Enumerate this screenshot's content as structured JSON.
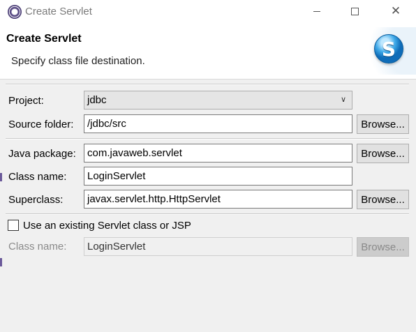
{
  "window": {
    "title": "Create Servlet",
    "icon": "eclipse-icon",
    "controls": {
      "minimize": "minimize-icon",
      "maximize": "maximize-icon",
      "close": "✕"
    }
  },
  "banner": {
    "title": "Create Servlet",
    "description": "Specify class file destination.",
    "logo_letter": "S"
  },
  "form": {
    "project": {
      "label": "Project:",
      "value": "jdbc"
    },
    "source_folder": {
      "label": "Source folder:",
      "value": "/jdbc/src",
      "button": "Browse..."
    },
    "java_package": {
      "label": "Java package:",
      "value": "com.javaweb.servlet",
      "button": "Browse..."
    },
    "class_name": {
      "label": "Class name:",
      "value": "LoginServlet"
    },
    "superclass": {
      "label": "Superclass:",
      "value": "javax.servlet.http.HttpServlet",
      "button": "Browse..."
    },
    "use_existing": {
      "label": "Use an existing Servlet class or JSP",
      "checked": false
    },
    "existing_class": {
      "label": "Class name:",
      "value": "LoginServlet",
      "button": "Browse..."
    }
  },
  "colors": {
    "accent": "#3fa9e8",
    "title_text": "#7a7a7a",
    "disabled_text": "#8a8a8a"
  }
}
